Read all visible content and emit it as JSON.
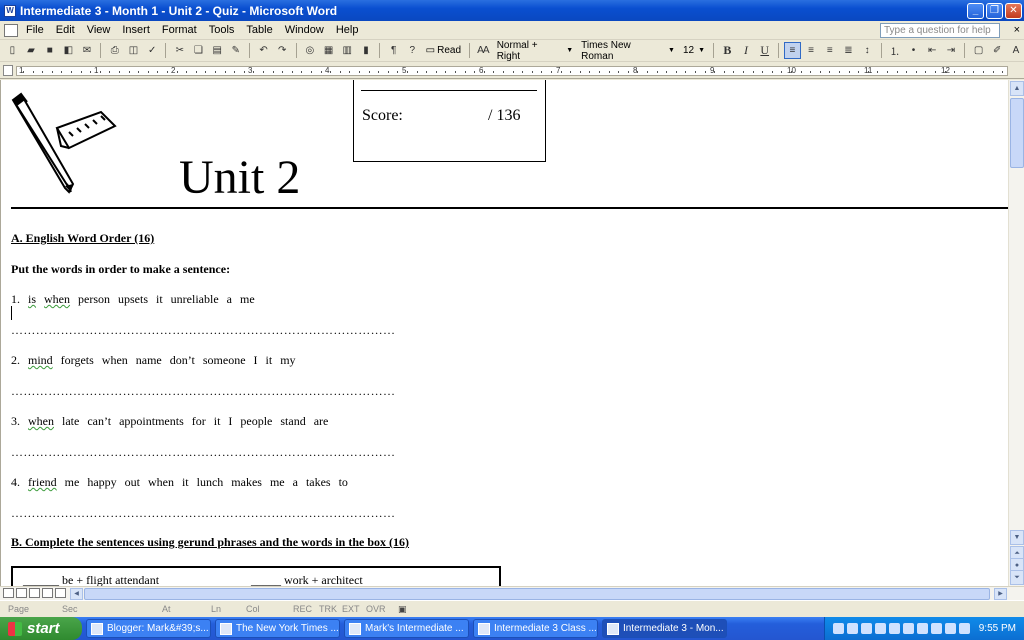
{
  "window": {
    "title": "Intermediate 3 - Month 1 - Unit 2 - Quiz - Microsoft Word",
    "app_icon": "W"
  },
  "menu": {
    "items": [
      "File",
      "Edit",
      "View",
      "Insert",
      "Format",
      "Tools",
      "Table",
      "Window",
      "Help"
    ],
    "help_placeholder": "Type a question for help",
    "close_glyph": "×"
  },
  "toolbar": {
    "read_label": "Read",
    "style": "Normal + Right",
    "font": "Times New Roman",
    "size": "12",
    "bold": "B",
    "italic": "I",
    "underline": "U",
    "pilcrow": "¶",
    "help_glyph": "?",
    "font_color": "A"
  },
  "ruler": {
    "numbers": [
      "1",
      "1",
      "2",
      "3",
      "4",
      "5",
      "6",
      "7",
      "8",
      "9",
      "10",
      "11",
      "12"
    ]
  },
  "document": {
    "score_label": "Score:",
    "score_value": "/ 136",
    "unit_title": "Unit 2",
    "section_a_heading": "A. English Word Order  (16)",
    "section_a_instruction": "Put the words in order to make a sentence:",
    "questions": [
      {
        "num": "1.",
        "first": "is",
        "second": "when",
        "rest": "person  upsets  it  unreliable  a  me"
      },
      {
        "num": "2.",
        "first": "mind",
        "second": "",
        "rest": "forgets  when  name  don’t  someone  I  it   my"
      },
      {
        "num": "3.",
        "first": "when",
        "second": "",
        "rest": "late  can’t  appointments  for  it  I   people  stand  are"
      },
      {
        "num": "4.",
        "first": "friend",
        "second": "",
        "rest": "me   happy  out   when   it   lunch   makes   me   a   takes   to"
      }
    ],
    "answer_dots": "…………………………………………………………………………………",
    "section_b_heading": "B. Complete the sentences using gerund phrases and the words in the box  (16)",
    "box_items": [
      "______ be + flight attendant",
      "_____ work + architect"
    ]
  },
  "statusbar": {
    "page": "Page",
    "sec": "Sec",
    "at": "At",
    "ln": "Ln",
    "col": "Col",
    "rec": "REC",
    "trk": "TRK",
    "ext": "EXT",
    "ovr": "OVR"
  },
  "taskbar": {
    "start_label": "start",
    "buttons": [
      "Blogger: Mark&#39;s...",
      "The New York Times ...",
      "Mark's Intermediate ...",
      "Intermediate 3 Class ...",
      "Intermediate 3 - Mon..."
    ],
    "clock": "9:55 PM"
  },
  "colors": {
    "titlebar": "#0a4fd0",
    "taskbar": "#245edb",
    "start_button": "#2f8a2f",
    "spell_squiggle": "#3a9a3a"
  }
}
